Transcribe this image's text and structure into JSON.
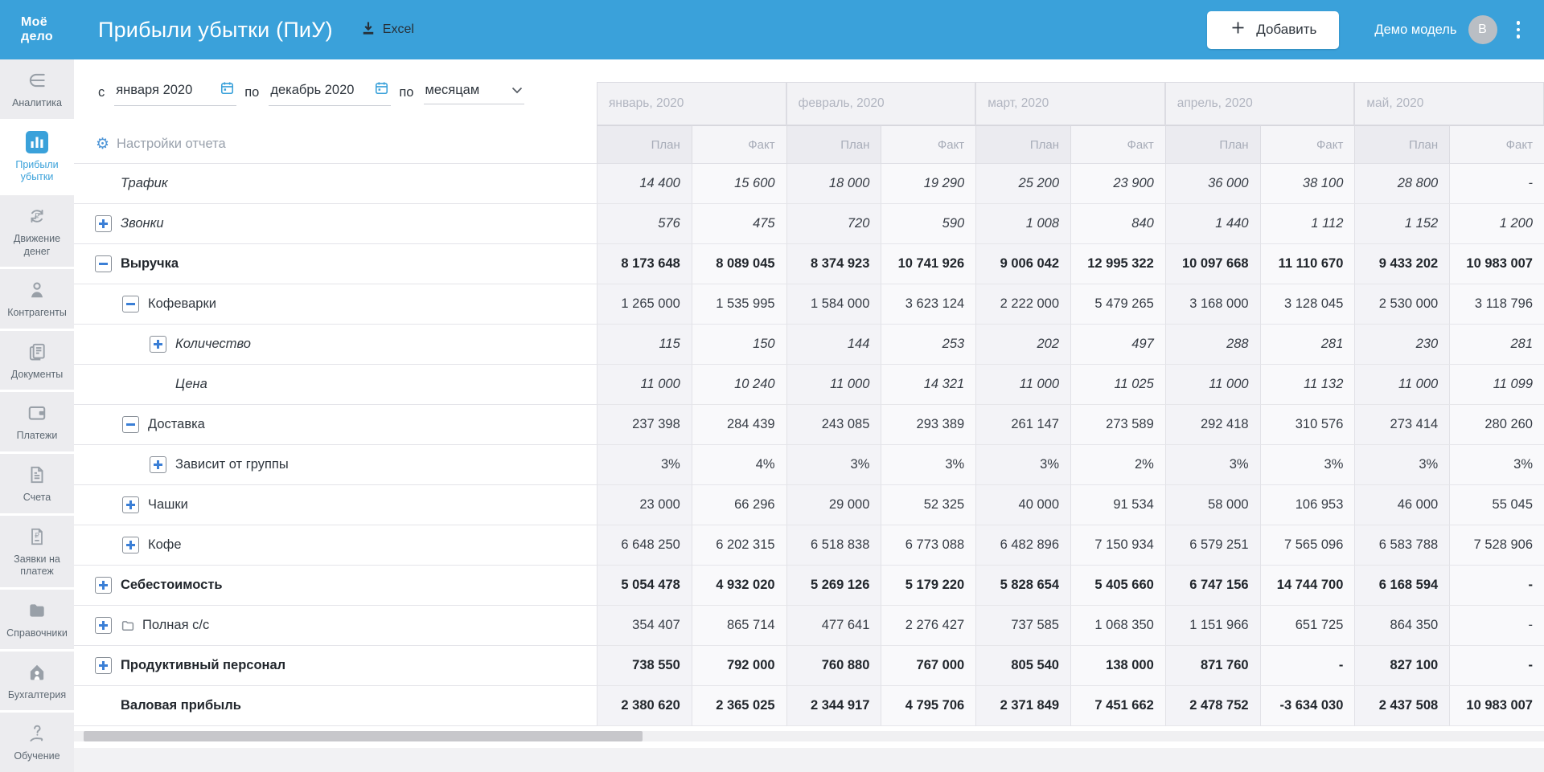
{
  "colors": {
    "accent_blue": "#3aa1da",
    "expander_blue": "#3b7fd6",
    "header_text": "#ffffff"
  },
  "topbar": {
    "logo_line1": "Моё",
    "logo_line2": "дело",
    "title": "Прибыли убытки (ПиУ)",
    "excel_label": "Excel",
    "add_label": "Добавить",
    "account_label": "Демо модель",
    "avatar_initial": "B"
  },
  "sidebar": {
    "items": [
      {
        "label": "Аналитика",
        "icon": "analytics",
        "active": false
      },
      {
        "label": "Прибыли убытки",
        "icon": "profit-loss",
        "active": true
      },
      {
        "label": "Движение денег",
        "icon": "cash-flow",
        "active": false
      },
      {
        "label": "Контрагенты",
        "icon": "contractors",
        "active": false
      },
      {
        "label": "Документы",
        "icon": "documents",
        "active": false
      },
      {
        "label": "Платежи",
        "icon": "payments",
        "active": false
      },
      {
        "label": "Счета",
        "icon": "invoices",
        "active": false
      },
      {
        "label": "Заявки на платеж",
        "icon": "payment-request",
        "active": false
      },
      {
        "label": "Справочники",
        "icon": "directories",
        "active": false
      },
      {
        "label": "Бухгалтерия",
        "icon": "accounting",
        "active": false
      },
      {
        "label": "Обучение",
        "icon": "education",
        "active": false,
        "bottom": true
      }
    ]
  },
  "filters": {
    "from_prefix": "с",
    "from_value": "января 2020",
    "to_prefix": "по",
    "to_value": "декабрь 2020",
    "group_prefix": "по",
    "group_value": "месяцам"
  },
  "report_settings_label": "Настройки отчета",
  "table": {
    "months": [
      "январь, 2020",
      "февраль, 2020",
      "март, 2020",
      "апрель, 2020",
      "май, 2020"
    ],
    "subheaders": [
      "План",
      "Факт"
    ],
    "rows": [
      {
        "label": "Трафик",
        "level": 0,
        "expander": null,
        "style": "italic",
        "values": [
          "14 400",
          "15 600",
          "18 000",
          "19 290",
          "25 200",
          "23 900",
          "36 000",
          "38 100",
          "28 800",
          "-"
        ]
      },
      {
        "label": "Звонки",
        "level": 0,
        "expander": "plus",
        "style": "italic",
        "values": [
          "576",
          "475",
          "720",
          "590",
          "1 008",
          "840",
          "1 440",
          "1 112",
          "1 152",
          "1 200"
        ]
      },
      {
        "label": "Выручка",
        "level": 0,
        "expander": "minus",
        "style": "bold",
        "values": [
          "8 173 648",
          "8 089 045",
          "8 374 923",
          "10 741 926",
          "9 006 042",
          "12 995 322",
          "10 097 668",
          "11 110 670",
          "9 433 202",
          "10 983 007"
        ]
      },
      {
        "label": "Кофеварки",
        "level": 1,
        "expander": "minus",
        "style": "normal",
        "values": [
          "1 265 000",
          "1 535 995",
          "1 584 000",
          "3 623 124",
          "2 222 000",
          "5 479 265",
          "3 168 000",
          "3 128 045",
          "2 530 000",
          "3 118 796"
        ]
      },
      {
        "label": "Количество",
        "level": 2,
        "expander": "plus",
        "style": "italic",
        "values": [
          "115",
          "150",
          "144",
          "253",
          "202",
          "497",
          "288",
          "281",
          "230",
          "281"
        ]
      },
      {
        "label": "Цена",
        "level": 2,
        "expander": null,
        "style": "italic",
        "values": [
          "11 000",
          "10 240",
          "11 000",
          "14 321",
          "11 000",
          "11 025",
          "11 000",
          "11 132",
          "11 000",
          "11 099"
        ]
      },
      {
        "label": "Доставка",
        "level": 1,
        "expander": "minus",
        "style": "normal",
        "values": [
          "237 398",
          "284 439",
          "243 085",
          "293 389",
          "261 147",
          "273 589",
          "292 418",
          "310 576",
          "273 414",
          "280 260"
        ]
      },
      {
        "label": "Зависит от группы",
        "level": 2,
        "expander": "plus",
        "style": "normal",
        "values": [
          "3%",
          "4%",
          "3%",
          "3%",
          "3%",
          "2%",
          "3%",
          "3%",
          "3%",
          "3%"
        ]
      },
      {
        "label": "Чашки",
        "level": 1,
        "expander": "plus",
        "style": "normal",
        "values": [
          "23 000",
          "66 296",
          "29 000",
          "52 325",
          "40 000",
          "91 534",
          "58 000",
          "106 953",
          "46 000",
          "55 045"
        ]
      },
      {
        "label": "Кофе",
        "level": 1,
        "expander": "plus",
        "style": "normal",
        "values": [
          "6 648 250",
          "6 202 315",
          "6 518 838",
          "6 773 088",
          "6 482 896",
          "7 150 934",
          "6 579 251",
          "7 565 096",
          "6 583 788",
          "7 528 906"
        ]
      },
      {
        "label": "Себестоимость",
        "level": 0,
        "expander": "plus",
        "style": "bold",
        "values": [
          "5 054 478",
          "4 932 020",
          "5 269 126",
          "5 179 220",
          "5 828 654",
          "5 405 660",
          "6 747 156",
          "14 744 700",
          "6 168 594",
          "-"
        ]
      },
      {
        "label": "Полная с/с",
        "level": 0,
        "expander": "plus",
        "icon": "folder",
        "style": "normal",
        "values": [
          "354 407",
          "865 714",
          "477 641",
          "2 276 427",
          "737 585",
          "1 068 350",
          "1 151 966",
          "651 725",
          "864 350",
          "-"
        ]
      },
      {
        "label": "Продуктивный персонал",
        "level": 0,
        "expander": "plus",
        "style": "bold",
        "values": [
          "738 550",
          "792 000",
          "760 880",
          "767 000",
          "805 540",
          "138 000",
          "871 760",
          "-",
          "827 100",
          "-"
        ]
      },
      {
        "label": "Валовая прибыль",
        "level": 0,
        "expander": null,
        "style": "bold",
        "values": [
          "2 380 620",
          "2 365 025",
          "2 344 917",
          "4 795 706",
          "2 371 849",
          "7 451 662",
          "2 478 752",
          "-3 634 030",
          "2 437 508",
          "10 983 007"
        ]
      }
    ]
  }
}
